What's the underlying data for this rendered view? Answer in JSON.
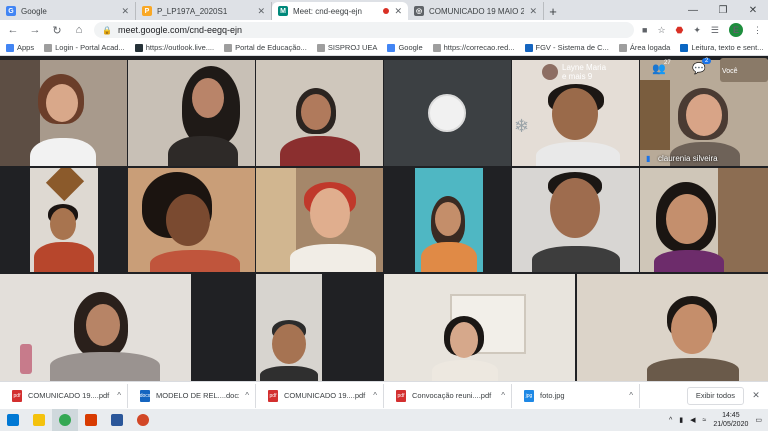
{
  "tabs": [
    {
      "title": "Google",
      "favicon": "google-icon",
      "color": "#4285f4",
      "letter": "G"
    },
    {
      "title": "P_LP197A_2020S1",
      "favicon": "doc-icon",
      "color": "#f9a825",
      "letter": "P"
    },
    {
      "title": "Meet: cnd-eegq-ejn",
      "favicon": "meet-icon",
      "color": "#00897b",
      "letter": "M",
      "active": true
    },
    {
      "title": "COMUNICADO 19 MAIO 2020.p",
      "favicon": "web-icon",
      "color": "#5f6368",
      "letter": "◎"
    }
  ],
  "new_tab": "+",
  "window_controls": {
    "minimize": "—",
    "maximize": "❐",
    "close": "✕"
  },
  "address_bar": {
    "url": "meet.google.com/cnd-eegq-ejn"
  },
  "profile_initial": "E",
  "bookmarks": [
    {
      "label": "Apps",
      "color": "#4285f4"
    },
    {
      "label": "Login - Portal Acad...",
      "color": "#9e9e9e"
    },
    {
      "label": "https://outlook.live....",
      "color": "#263238"
    },
    {
      "label": "Portal de Educação...",
      "color": "#9e9e9e"
    },
    {
      "label": "SISPROJ UEA",
      "color": "#9e9e9e"
    },
    {
      "label": "Google",
      "color": "#4285f4"
    },
    {
      "label": "https://correcao.red...",
      "color": "#9e9e9e"
    },
    {
      "label": "FGV - Sistema de C...",
      "color": "#1565c0"
    },
    {
      "label": "Área logada",
      "color": "#9e9e9e"
    },
    {
      "label": "Leitura, texto e sent...",
      "color": "#0a66c2"
    }
  ],
  "meet": {
    "presenter_label": "Layne Maria",
    "presenter_sub": "e mais 9",
    "participants_count": "27",
    "chat_badge": "2",
    "self_label": "Você",
    "tile_name": "claurenia silveira"
  },
  "downloads": [
    {
      "file": "COMUNICADO 19....pdf",
      "type": "pdf",
      "color": "#d32f2f"
    },
    {
      "file": "MODELO DE REL....docx",
      "type": "docx",
      "color": "#1565c0"
    },
    {
      "file": "COMUNICADO 19....pdf",
      "type": "pdf",
      "color": "#d32f2f"
    },
    {
      "file": "Convocação reuni....pdf",
      "type": "pdf",
      "color": "#d32f2f"
    },
    {
      "file": "foto.jpg",
      "type": "jpg",
      "color": "#1e88e5"
    }
  ],
  "show_all_label": "Exibir todos",
  "taskbar": {
    "time": "14:45",
    "date": "21/05/2020"
  }
}
